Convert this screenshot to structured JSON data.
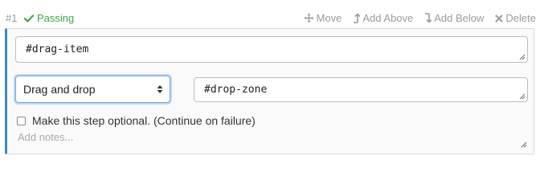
{
  "step": {
    "number": "#1",
    "status": "Passing"
  },
  "actions": {
    "move": "Move",
    "add_above": "Add Above",
    "add_below": "Add Below",
    "delete": "Delete"
  },
  "fields": {
    "selector_value": "#drag-item",
    "action_selected": "Drag and drop",
    "target_value": "#drop-zone"
  },
  "optional": {
    "label": "Make this step optional. (Continue on failure)",
    "checked": false
  },
  "notes": {
    "placeholder": "Add notes..."
  },
  "colors": {
    "passing": "#3fa64a",
    "accent": "#3f89c6",
    "muted": "#9b9b9b"
  },
  "icons": {
    "status": "check-icon",
    "move": "move-icon",
    "add_above": "arrow-up-icon",
    "add_below": "arrow-down-icon",
    "delete": "close-icon",
    "select": "select-arrows-icon"
  }
}
